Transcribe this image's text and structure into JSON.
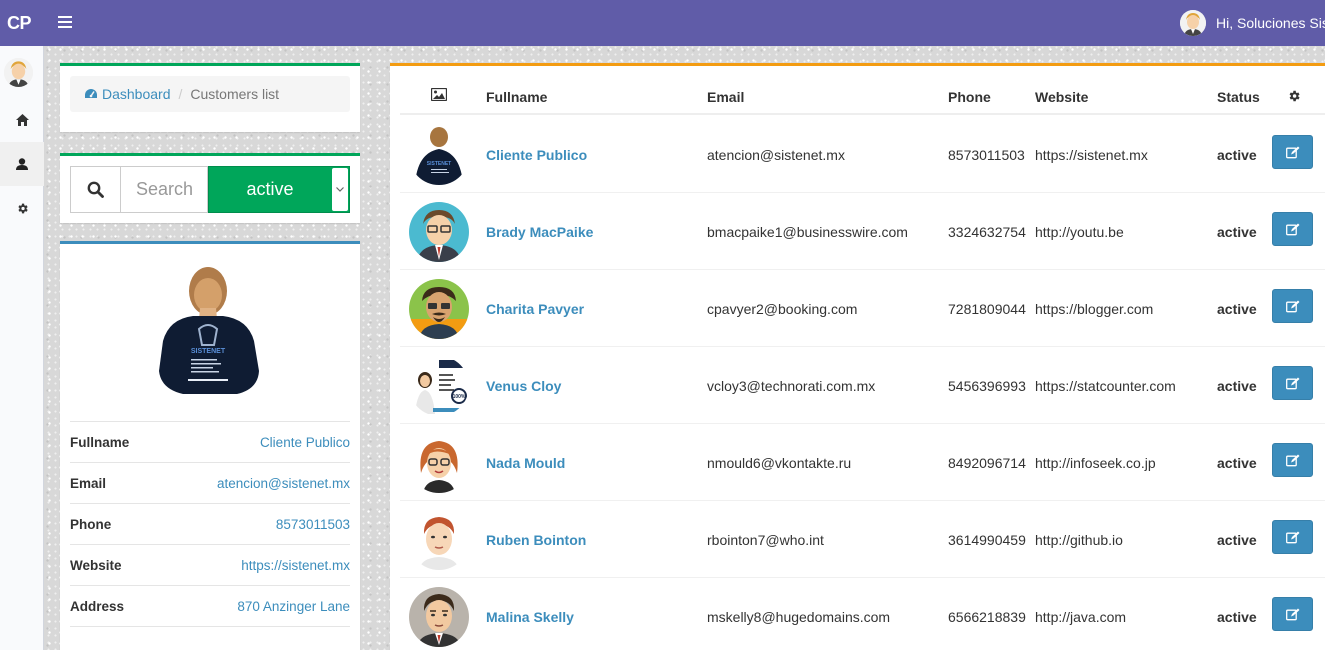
{
  "topbar": {
    "logo": "CP",
    "user_greeting": "Hi, Soluciones Sistenet"
  },
  "breadcrumb": {
    "dashboard": "Dashboard",
    "current": "Customers list"
  },
  "search": {
    "placeholder": "Search",
    "status_value": "active"
  },
  "profile": {
    "rows": [
      {
        "label": "Fullname",
        "value": "Cliente Publico"
      },
      {
        "label": "Email",
        "value": "atencion@sistenet.mx"
      },
      {
        "label": "Phone",
        "value": "8573011503"
      },
      {
        "label": "Website",
        "value": "https://sistenet.mx"
      },
      {
        "label": "Address",
        "value": "870 Anzinger Lane"
      }
    ]
  },
  "table": {
    "headers": {
      "fullname": "Fullname",
      "email": "Email",
      "phone": "Phone",
      "website": "Website",
      "status": "Status"
    },
    "rows": [
      {
        "name": "Cliente Publico",
        "email": "atencion@sistenet.mx",
        "phone": "8573011503",
        "website": "https://sistenet.mx",
        "status": "active"
      },
      {
        "name": "Brady MacPaike",
        "email": "bmacpaike1@businesswire.com",
        "phone": "3324632754",
        "website": "http://youtu.be",
        "status": "active"
      },
      {
        "name": "Charita Pavyer",
        "email": "cpavyer2@booking.com",
        "phone": "7281809044",
        "website": "https://blogger.com",
        "status": "active"
      },
      {
        "name": "Venus Cloy",
        "email": "vcloy3@technorati.com.mx",
        "phone": "5456396993",
        "website": "https://statcounter.com",
        "status": "active"
      },
      {
        "name": "Nada Mould",
        "email": "nmould6@vkontakte.ru",
        "phone": "8492096714",
        "website": "http://infoseek.co.jp",
        "status": "active"
      },
      {
        "name": "Ruben Bointon",
        "email": "rbointon7@who.int",
        "phone": "3614990459",
        "website": "http://github.io",
        "status": "active"
      },
      {
        "name": "Malina Skelly",
        "email": "mskelly8@hugedomains.com",
        "phone": "6566218839",
        "website": "http://java.com",
        "status": "active"
      }
    ]
  },
  "colors": {
    "topbar": "#605ca8",
    "link": "#3c8dbc",
    "success": "#00a65a",
    "warning": "#f39c12"
  }
}
